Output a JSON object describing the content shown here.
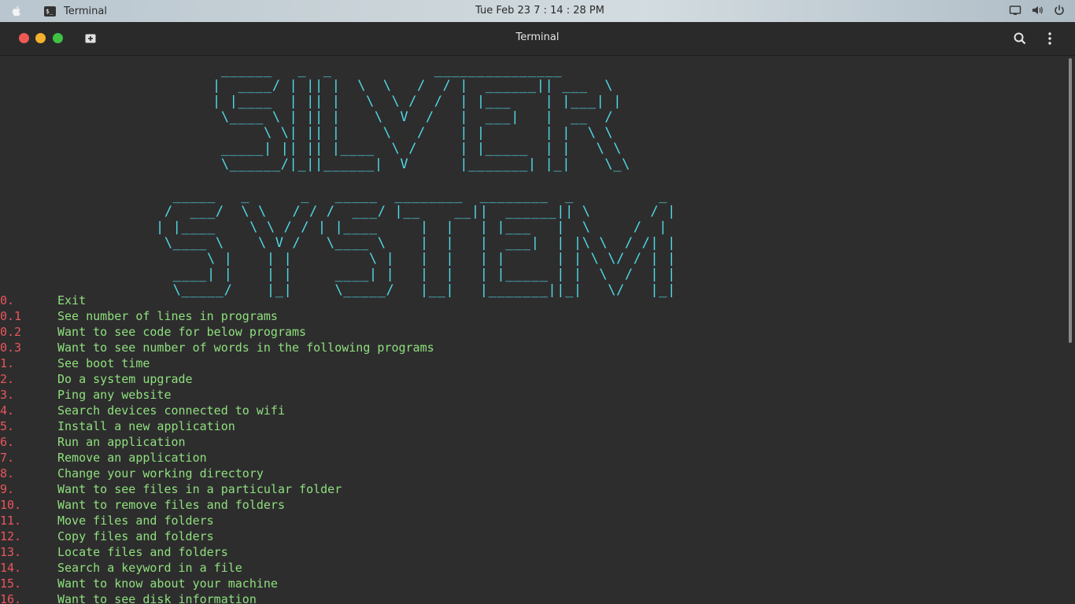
{
  "topbar": {
    "app_name": "Terminal",
    "app_icon_text": "$_",
    "datetime": "Tue Feb 23   7 : 14 : 28 PM"
  },
  "window": {
    "title": "Terminal"
  },
  "terminal": {
    "banner_line1": " ______   _  _            _______________\n|  ____/ | || |  \\  \\   /  / |  ______|| ___  \\\n| |____  | || |   \\  \\ /  /  | |___    | |___| |\n \\____ \\ | || |    \\  V  /   |  ___|   |  __  /\n      \\ \\| || |     \\   /    | |       | |  \\ \\\n _____| || || |____  \\ /     | |_____  | |   \\ \\\n \\______/|_||______|  V      |_______| |_|    \\_\\",
    "banner_line2": "  _____   _      _   _____  ________  ________  _          _\n /  ___/  \\ \\   / / /  ___/ |__    __||  ______|| \\       / |\n| |____    \\ \\ / / | |____     |  |   | |___   |  \\     /  |\n \\____ \\    \\ V /   \\____ \\    |  |   |  ___|  | |\\ \\  / /| |\n      \\ |    | |         \\ |   |  |   | |      | | \\ \\/ / | |\n  ____| |    | |     ____| |   |  |   | |_____ | |  \\  /  | |\n  \\_____/    |_|     \\_____/   |__|   |_______||_|   \\/   |_|",
    "menu": [
      {
        "num": "0.",
        "label": "Exit"
      },
      {
        "num": "0.1",
        "label": "See number of lines in programs"
      },
      {
        "num": "0.2",
        "label": "Want to see code for below programs"
      },
      {
        "num": "0.3",
        "label": "Want to see number of words in the following programs"
      },
      {
        "num": "1.",
        "label": "See boot time"
      },
      {
        "num": "2.",
        "label": "Do a system upgrade"
      },
      {
        "num": "3.",
        "label": "Ping any website"
      },
      {
        "num": "4.",
        "label": "Search devices connected to wifi"
      },
      {
        "num": "5.",
        "label": "Install a new application"
      },
      {
        "num": "6.",
        "label": "Run an application"
      },
      {
        "num": "7.",
        "label": "Remove an application"
      },
      {
        "num": "8.",
        "label": "Change your working directory"
      },
      {
        "num": "9.",
        "label": "Want to see files in a particular folder"
      },
      {
        "num": "10.",
        "label": "Want to remove files and folders"
      },
      {
        "num": "11.",
        "label": "Move files and folders"
      },
      {
        "num": "12.",
        "label": "Copy files and folders"
      },
      {
        "num": "13.",
        "label": "Locate files and folders"
      },
      {
        "num": "14.",
        "label": "Search a keyword in a file"
      },
      {
        "num": "15.",
        "label": "Want to know about your machine"
      },
      {
        "num": "16.",
        "label": "Want to see disk information"
      }
    ]
  },
  "icons": {
    "apple": "apple-icon",
    "terminal_app": "terminal-app-icon",
    "screen": "screen-icon",
    "volume": "volume-icon",
    "power": "power-icon",
    "new_tab": "new-tab-icon",
    "search": "search-icon",
    "menu": "kebab-menu-icon"
  },
  "colors": {
    "banner": "#4fd9e4",
    "menu_number": "#e8575a",
    "menu_label": "#8ee07d",
    "terminal_bg": "#2e2d2e"
  }
}
